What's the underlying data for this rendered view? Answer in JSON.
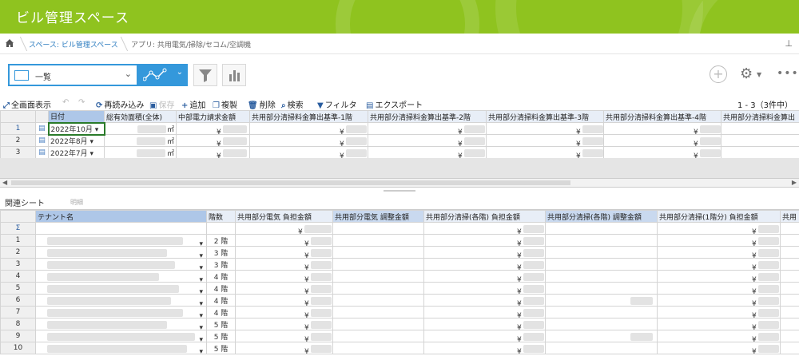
{
  "app": {
    "title": "ビル管理スペース"
  },
  "breadcrumb": {
    "space": "スペース: ビル管理スペース",
    "app": "アプリ: 共用電気/掃除/セコム/空調機"
  },
  "view": {
    "selected": "一覧"
  },
  "toolbar": {
    "fullscreen": "全画面表示",
    "reload": "再読み込み",
    "save": "保存",
    "add": "追加",
    "copy": "複製",
    "delete": "削除",
    "search": "検索",
    "filter": "フィルタ",
    "export": "エクスポート",
    "count": "1 - 3（3件中）"
  },
  "grid1": {
    "columns": [
      "日付",
      "総有効面積(全体)",
      "中部電力請求金額",
      "共用部分清掃料金算出基準-1階",
      "共用部分清掃料金算出基準-2階",
      "共用部分清掃料金算出基準-3階",
      "共用部分清掃料金算出基準-4階",
      "共用部分清掃料金算出"
    ],
    "rows": [
      {
        "n": "1",
        "date": "2022年10月",
        "unit": "㎡",
        "yen": "¥"
      },
      {
        "n": "2",
        "date": "2022年8月",
        "unit": "㎡",
        "yen": "¥"
      },
      {
        "n": "3",
        "date": "2022年7月",
        "unit": "㎡",
        "yen": "¥"
      }
    ]
  },
  "related": {
    "tab": "関連シート",
    "detail": "明細"
  },
  "grid2": {
    "columns": [
      "テナント名",
      "階数",
      "共用部分電気 負担金額",
      "共用部分電気 調整金額",
      "共用部分清掃(各階) 負担金額",
      "共用部分清掃(各階) 調整金額",
      "共用部分清掃(1階分) 負担金額",
      "共用"
    ],
    "sigma": "Σ",
    "yen": "¥",
    "rows": [
      {
        "n": "1",
        "floor": "2 階"
      },
      {
        "n": "2",
        "floor": "3 階"
      },
      {
        "n": "3",
        "floor": "3 階"
      },
      {
        "n": "4",
        "floor": "4 階"
      },
      {
        "n": "5",
        "floor": "4 階"
      },
      {
        "n": "6",
        "floor": "4 階"
      },
      {
        "n": "7",
        "floor": "4 階"
      },
      {
        "n": "8",
        "floor": "5 階"
      },
      {
        "n": "9",
        "floor": "5 階"
      },
      {
        "n": "10",
        "floor": "5 階"
      }
    ]
  }
}
